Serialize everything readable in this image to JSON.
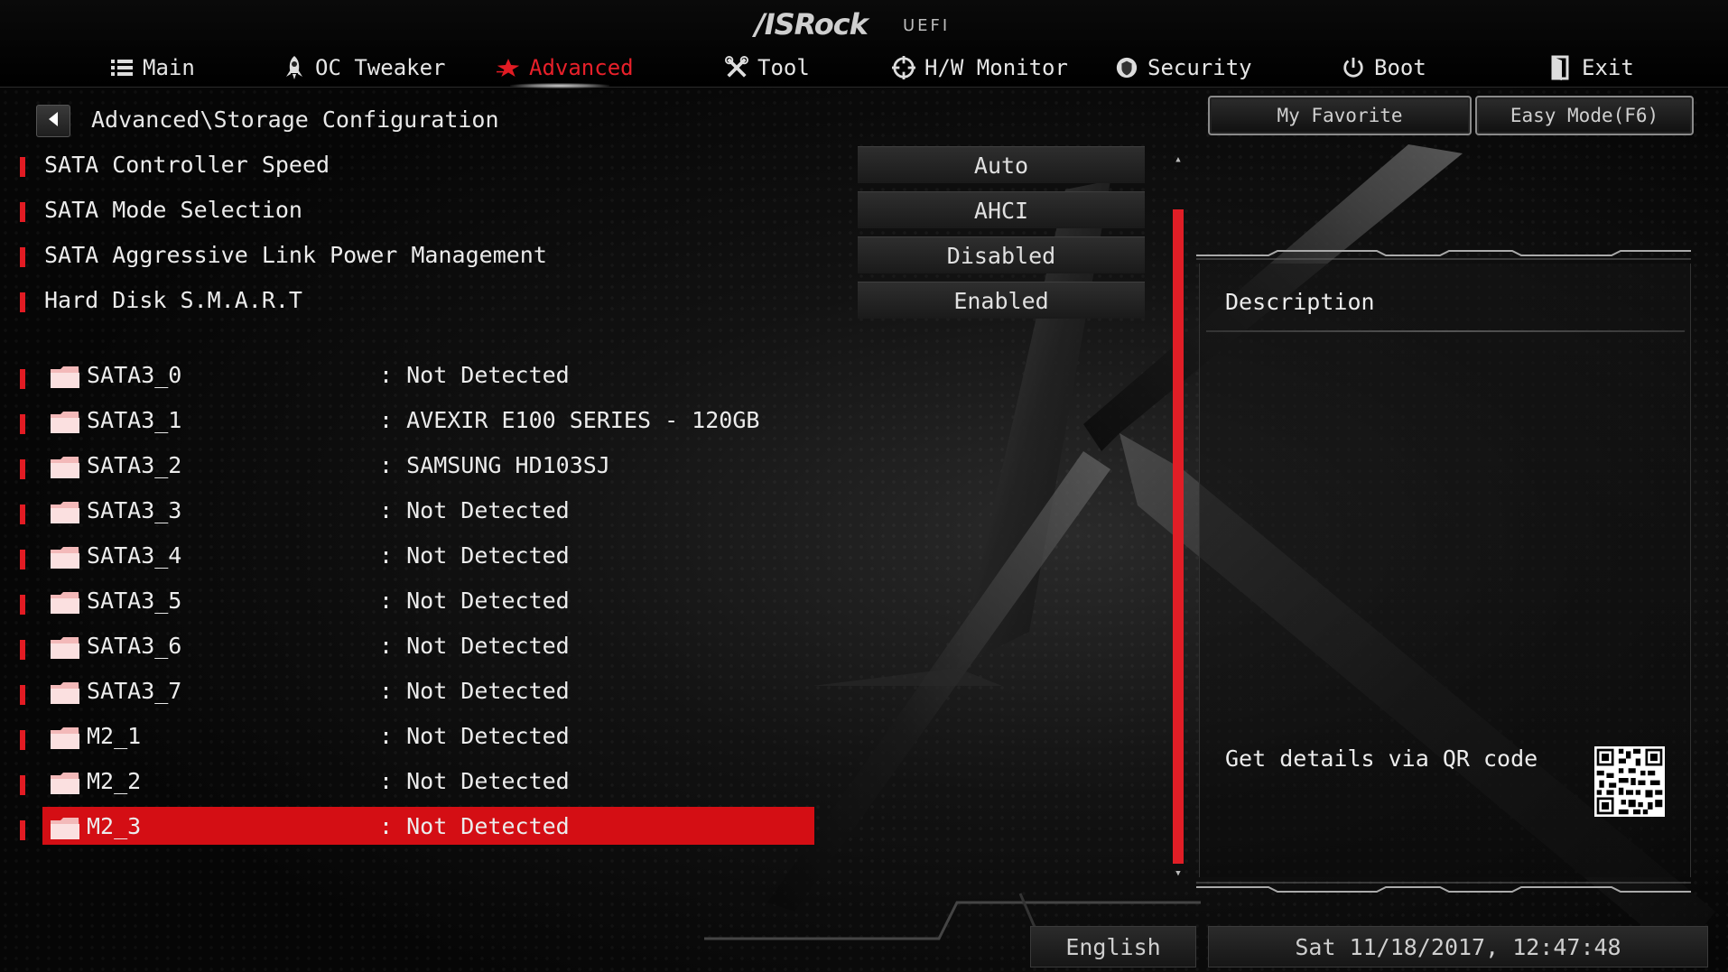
{
  "header": {
    "brand": "/ISRock",
    "brand_sub": "UEFI",
    "nav": [
      {
        "label": "Main",
        "icon": "list-icon"
      },
      {
        "label": "OC Tweaker",
        "icon": "rocket-icon"
      },
      {
        "label": "Advanced",
        "icon": "star-icon",
        "active": true
      },
      {
        "label": "Tool",
        "icon": "tools-icon"
      },
      {
        "label": "H/W Monitor",
        "icon": "crosshair-icon"
      },
      {
        "label": "Security",
        "icon": "shield-icon"
      },
      {
        "label": "Boot",
        "icon": "power-icon"
      },
      {
        "label": "Exit",
        "icon": "exit-door-icon"
      }
    ]
  },
  "breadcrumb": "Advanced\\Storage Configuration",
  "buttons": {
    "favorite": "My Favorite",
    "easy_mode": "Easy Mode(F6)"
  },
  "settings": [
    {
      "label": "SATA Controller Speed",
      "value": "Auto"
    },
    {
      "label": "SATA Mode Selection",
      "value": "AHCI"
    },
    {
      "label": "SATA Aggressive Link Power Management",
      "value": "Disabled"
    },
    {
      "label": "Hard Disk S.M.A.R.T",
      "value": "Enabled"
    }
  ],
  "drives": [
    {
      "name": "SATA3_0",
      "value": ": Not Detected"
    },
    {
      "name": "SATA3_1",
      "value": ": AVEXIR E100 SERIES - 120GB"
    },
    {
      "name": "SATA3_2",
      "value": ": SAMSUNG HD103SJ"
    },
    {
      "name": "SATA3_3",
      "value": ": Not Detected"
    },
    {
      "name": "SATA3_4",
      "value": ": Not Detected"
    },
    {
      "name": "SATA3_5",
      "value": ": Not Detected"
    },
    {
      "name": "SATA3_6",
      "value": ": Not Detected"
    },
    {
      "name": "SATA3_7",
      "value": ": Not Detected"
    },
    {
      "name": "M2_1",
      "value": ": Not Detected"
    },
    {
      "name": "M2_2",
      "value": ": Not Detected"
    },
    {
      "name": "M2_3",
      "value": ": Not Detected",
      "selected": true
    }
  ],
  "description": {
    "title": "Description",
    "qr_text": "Get details via QR code"
  },
  "footer": {
    "language": "English",
    "datetime": "Sat 11/18/2017, 12:47:48"
  },
  "colors": {
    "accent": "#e21b23",
    "selection": "#d40e14",
    "text": "#ececec"
  }
}
